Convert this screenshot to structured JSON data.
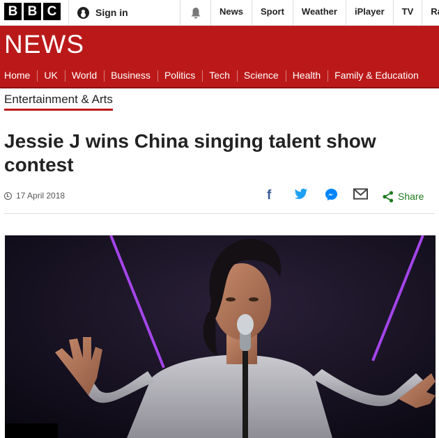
{
  "topbar": {
    "bbc_letters": [
      "B",
      "B",
      "C"
    ],
    "signin_label": "Sign in",
    "links": [
      "News",
      "Sport",
      "Weather",
      "iPlayer",
      "TV",
      "Radi"
    ]
  },
  "masthead": {
    "title": "NEWS"
  },
  "nav": {
    "items": [
      "Home",
      "UK",
      "World",
      "Business",
      "Politics",
      "Tech",
      "Science",
      "Health",
      "Family & Education"
    ]
  },
  "article": {
    "section": "Entertainment & Arts",
    "headline": "Jessie J wins China singing talent show contest",
    "date": "17 April 2018"
  },
  "share": {
    "label": "Share"
  },
  "icons": {
    "facebook": "facebook-icon",
    "twitter": "twitter-icon",
    "messenger": "messenger-icon",
    "email": "email-icon",
    "share": "share-icon",
    "bell": "notification-bell-icon",
    "user": "user-icon",
    "clock": "clock-icon"
  },
  "colors": {
    "brand_red": "#bb1919",
    "share_green": "#1f7a1f",
    "facebook": "#3b5998",
    "twitter": "#1da1f2",
    "messenger": "#0084ff"
  }
}
